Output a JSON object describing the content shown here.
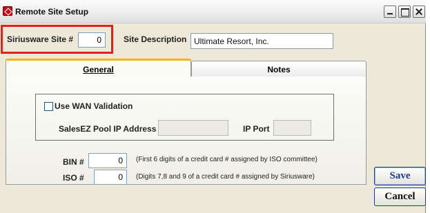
{
  "window": {
    "title": "Remote Site Setup"
  },
  "header": {
    "site_number_label": "Siriusware Site #",
    "site_number_value": "0",
    "site_description_label": "Site Description",
    "site_description_value": "Ultimate Resort, Inc."
  },
  "tabs": [
    {
      "label": "General",
      "active": true
    },
    {
      "label": "Notes",
      "active": false
    }
  ],
  "general": {
    "wan_validation_label": "Use WAN Validation",
    "wan_validation_checked": false,
    "pool_ip_label": "SalesEZ Pool IP Address",
    "pool_ip_value": "",
    "ip_port_label": "IP Port",
    "ip_port_value": "",
    "bin_label": "BIN #",
    "bin_value": "0",
    "bin_hint": "(First 6 digits of a credit card # assigned by ISO committee)",
    "iso_label": "ISO #",
    "iso_value": "0",
    "iso_hint": "(Digits 7,8 and 9 of a credit card # assigned by Siriusware)"
  },
  "buttons": {
    "save": "Save",
    "cancel": "Cancel"
  },
  "colors": {
    "highlight": "#e0201a",
    "active_tab_accent": "#f2b21b",
    "save_text": "#1a3a8a"
  }
}
